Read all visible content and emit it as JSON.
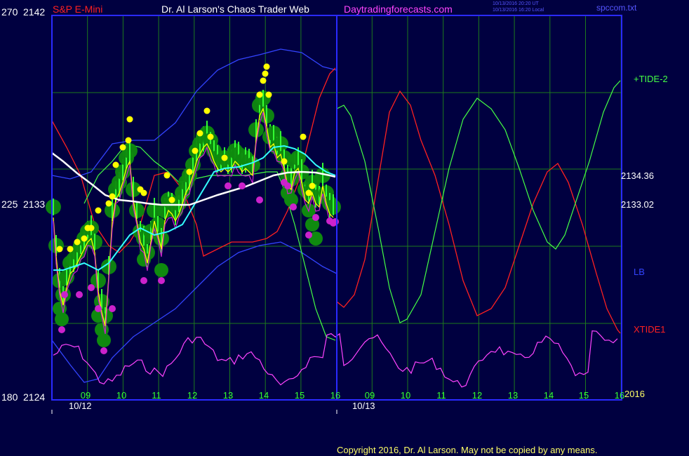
{
  "header": {
    "instrument": "S&P E-Mini",
    "site_title": "Dr. Al Larson's Chaos Trader Web",
    "site_url": "Daytradingforecasts.com",
    "timestamp_utc": "10/13/2016 20:20 UT",
    "timestamp_local": "10/13/2016 16:20 Local",
    "data_file": "spccom.txt"
  },
  "footer": {
    "copyright": "Copyright 2016, Dr. Al Larson. May not be copied by any means."
  },
  "colors": {
    "background": "#000040",
    "frame": "#2a2aff",
    "grid": "#1d7a1d",
    "price": "#00ff00",
    "yellow": "#ffff00",
    "magenta": "#cc22cc",
    "cyan": "#33ffff",
    "white": "#ffffff",
    "red_band": "#ff2020",
    "green_line": "#44ff44",
    "pink": "#ff44ff",
    "blue_band": "#3344ff"
  },
  "chart_data": {
    "type": "line",
    "title": "S&P E-Mini",
    "left_axis": [
      {
        "index": "270",
        "price": "2142"
      },
      {
        "index": "225",
        "price": "2133"
      },
      {
        "index": "180",
        "price": "2124"
      }
    ],
    "ylim": [
      2124,
      2142
    ],
    "x_ticks": [
      "09",
      "10",
      "11",
      "12",
      "13",
      "14",
      "15",
      "16",
      "09",
      "10",
      "11",
      "12",
      "13",
      "14",
      "15",
      "16"
    ],
    "dates": [
      "10/12",
      "10/13"
    ],
    "year": "2016",
    "right_labels": [
      {
        "text": "+TIDE-2",
        "color": "#44ff44"
      },
      {
        "text": "2134.36",
        "color": "#ffffff"
      },
      {
        "text": "2133.02",
        "color": "#ffffff"
      },
      {
        "text": "LB",
        "color": "#3344ff"
      },
      {
        "text": "XTIDE1",
        "color": "#ff2020"
      }
    ],
    "series": [
      {
        "name": "+TIDE-2",
        "color": "#44ff44"
      },
      {
        "name": "XTIDE1",
        "color": "#ff2020"
      },
      {
        "name": "LB",
        "color": "#3344ff"
      }
    ]
  }
}
